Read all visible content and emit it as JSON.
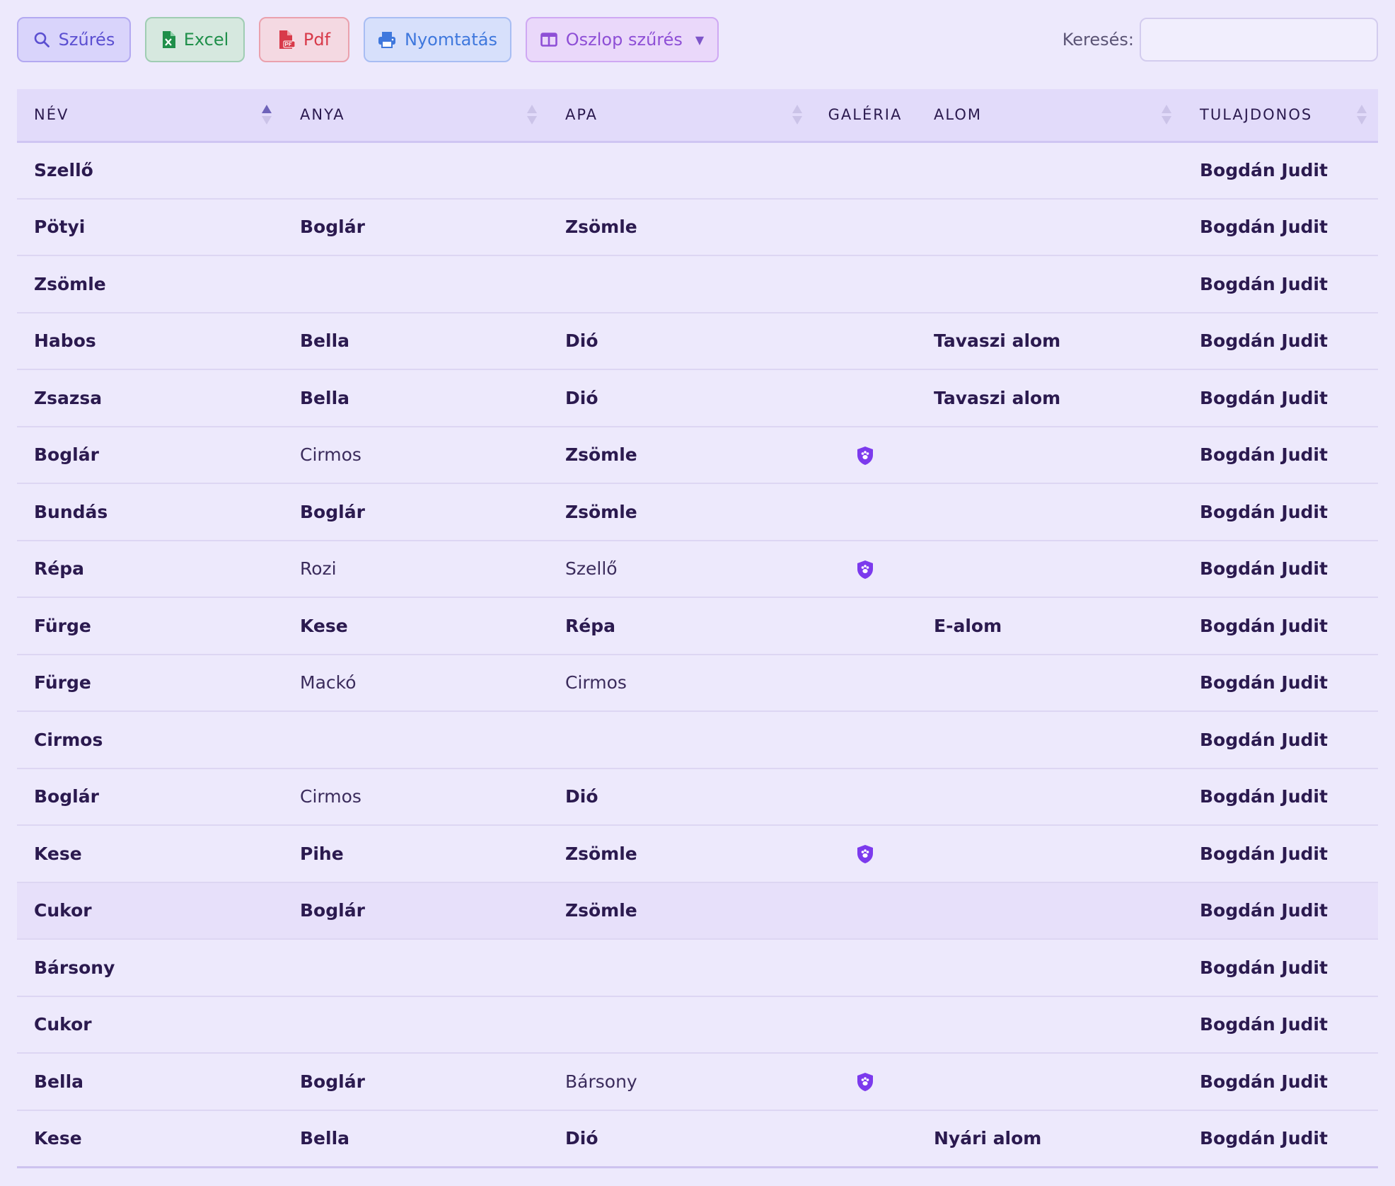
{
  "toolbar": {
    "filter_label": "Szűrés",
    "excel_label": "Excel",
    "pdf_label": "Pdf",
    "print_label": "Nyomtatás",
    "columns_label": "Oszlop szűrés",
    "columns_caret": "▼"
  },
  "search": {
    "label": "Keresés:",
    "value": "",
    "placeholder": ""
  },
  "columns": {
    "nev": "NÉV",
    "anya": "ANYA",
    "apa": "APA",
    "galeria": "GALÉRIA",
    "alom": "ALOM",
    "tulajdonos": "TULAJDONOS"
  },
  "rows": [
    {
      "nev": "Szellő",
      "anya": "",
      "apa": "",
      "galeria": false,
      "alom": "",
      "tulajdonos": "Bogdán Judit"
    },
    {
      "nev": "Pötyi",
      "anya": "Boglár",
      "apa": "Zsömle",
      "galeria": false,
      "alom": "",
      "tulajdonos": "Bogdán Judit"
    },
    {
      "nev": "Zsömle",
      "anya": "",
      "apa": "",
      "galeria": false,
      "alom": "",
      "tulajdonos": "Bogdán Judit"
    },
    {
      "nev": "Habos",
      "anya": "Bella",
      "apa": "Dió",
      "galeria": false,
      "alom": "Tavaszi alom",
      "tulajdonos": "Bogdán Judit"
    },
    {
      "nev": "Zsazsa",
      "anya": "Bella",
      "apa": "Dió",
      "galeria": false,
      "alom": "Tavaszi alom",
      "tulajdonos": "Bogdán Judit"
    },
    {
      "nev": "Boglár",
      "anya": "Cirmos",
      "apa": "Zsömle",
      "galeria": true,
      "alom": "",
      "tulajdonos": "Bogdán Judit"
    },
    {
      "nev": "Bundás",
      "anya": "Boglár",
      "apa": "Zsömle",
      "galeria": false,
      "alom": "",
      "tulajdonos": "Bogdán Judit"
    },
    {
      "nev": "Répa",
      "anya": "Rozi",
      "apa": "Szellő",
      "galeria": true,
      "alom": "",
      "tulajdonos": "Bogdán Judit"
    },
    {
      "nev": "Fürge",
      "anya": "Kese",
      "apa": "Répa",
      "galeria": false,
      "alom": "E-alom",
      "tulajdonos": "Bogdán Judit"
    },
    {
      "nev": "Fürge",
      "anya": "Mackó",
      "apa": "Cirmos",
      "galeria": false,
      "alom": "",
      "tulajdonos": "Bogdán Judit"
    },
    {
      "nev": "Cirmos",
      "anya": "",
      "apa": "",
      "galeria": false,
      "alom": "",
      "tulajdonos": "Bogdán Judit"
    },
    {
      "nev": "Boglár",
      "anya": "Cirmos",
      "apa": "Dió",
      "galeria": false,
      "alom": "",
      "tulajdonos": "Bogdán Judit"
    },
    {
      "nev": "Kese",
      "anya": "Pihe",
      "apa": "Zsömle",
      "galeria": true,
      "alom": "",
      "tulajdonos": "Bogdán Judit"
    },
    {
      "nev": "Cukor",
      "anya": "Boglár",
      "apa": "Zsömle",
      "galeria": false,
      "alom": "",
      "tulajdonos": "Bogdán Judit"
    },
    {
      "nev": "Bársony",
      "anya": "",
      "apa": "",
      "galeria": false,
      "alom": "",
      "tulajdonos": "Bogdán Judit"
    },
    {
      "nev": "Cukor",
      "anya": "",
      "apa": "",
      "galeria": false,
      "alom": "",
      "tulajdonos": "Bogdán Judit"
    },
    {
      "nev": "Bella",
      "anya": "Boglár",
      "apa": "Bársony",
      "galeria": true,
      "alom": "",
      "tulajdonos": "Bogdán Judit"
    },
    {
      "nev": "Kese",
      "anya": "Bella",
      "apa": "Dió",
      "galeria": false,
      "alom": "Nyári alom",
      "tulajdonos": "Bogdán Judit"
    }
  ],
  "colors": {
    "accent": "#7c4ddf",
    "gallery_icon": "#7c3aed",
    "background": "#ede9fc"
  }
}
